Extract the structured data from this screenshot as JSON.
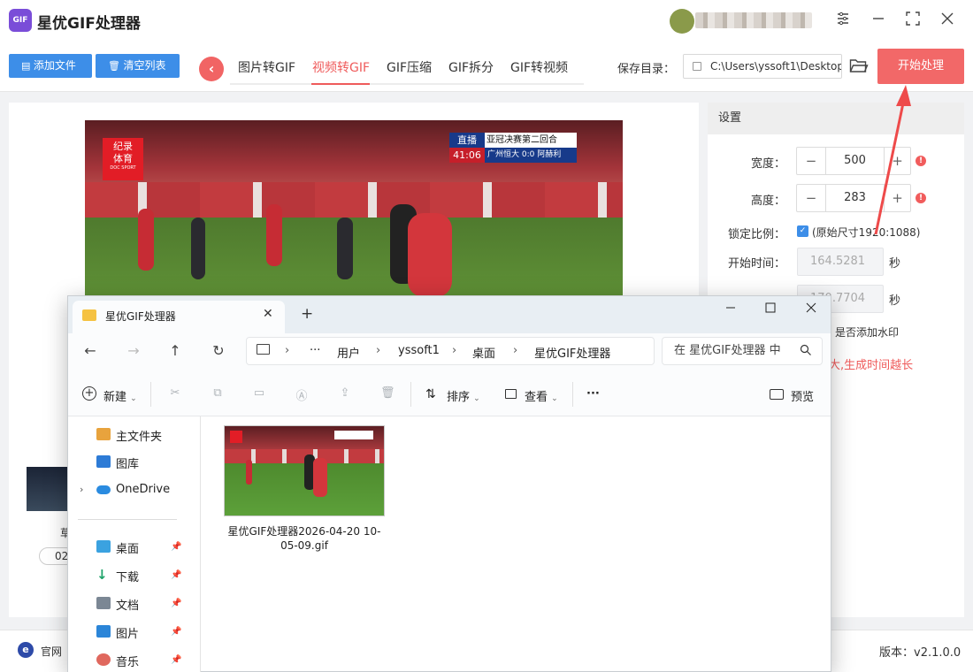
{
  "app": {
    "title": "星优GIF处理器",
    "logo_text": "GIF"
  },
  "toolbar": {
    "add_file": "添加文件",
    "clear_list": "清空列表",
    "tabs": [
      "图片转GIF",
      "视频转GIF",
      "GIF压缩",
      "GIF拆分",
      "GIF转视频"
    ],
    "active_tab": "视频转GIF",
    "save_dir_label": "保存目录：",
    "save_dir_value": "C:\\Users\\yssoft1\\Desktop",
    "start_button": "开始处理"
  },
  "video": {
    "logo_line1": "纪录",
    "logo_line2": "体育",
    "logo_sub": "DOC SPORT",
    "live_tag": "直播",
    "match_title": "亚冠决赛第二回合",
    "time": "41:06",
    "score": "广州恒大 0:0 阿赫利"
  },
  "settings": {
    "header": "设置",
    "width_label": "宽度：",
    "width_value": "500",
    "height_label": "高度：",
    "height_value": "283",
    "lock_label": "锁定比例：",
    "lock_note": "(原始尺寸1920:1088)",
    "start_time_label": "开始时间：",
    "start_time_value": "164.5281",
    "start_unit": "秒",
    "end_time_value": "170.7704",
    "end_unit": "秒",
    "watermark": "是否添加水印",
    "tip": "大,生成时间越长"
  },
  "file_list": {
    "partial_name": "草",
    "partial_badge": "02"
  },
  "footer": {
    "website": "官网",
    "version": "版本：v2.1.0.0"
  },
  "explorer": {
    "tab_title": "星优GIF处理器",
    "breadcrumb": [
      "用户",
      "yssoft1",
      "桌面",
      "星优GIF处理器"
    ],
    "search_placeholder": "在 星优GIF处理器 中",
    "commands": {
      "new": "新建",
      "sort": "排序",
      "view": "查看",
      "preview": "预览",
      "more": "···"
    },
    "sidebar": [
      "主文件夹",
      "图库",
      "OneDrive",
      "桌面",
      "下载",
      "文档",
      "图片",
      "音乐"
    ],
    "file": {
      "name": "星优GIF处理器2026-04-20 10-05-09.gif"
    }
  },
  "colors": {
    "accent": "#f26868",
    "primary": "#3d8ee8"
  }
}
